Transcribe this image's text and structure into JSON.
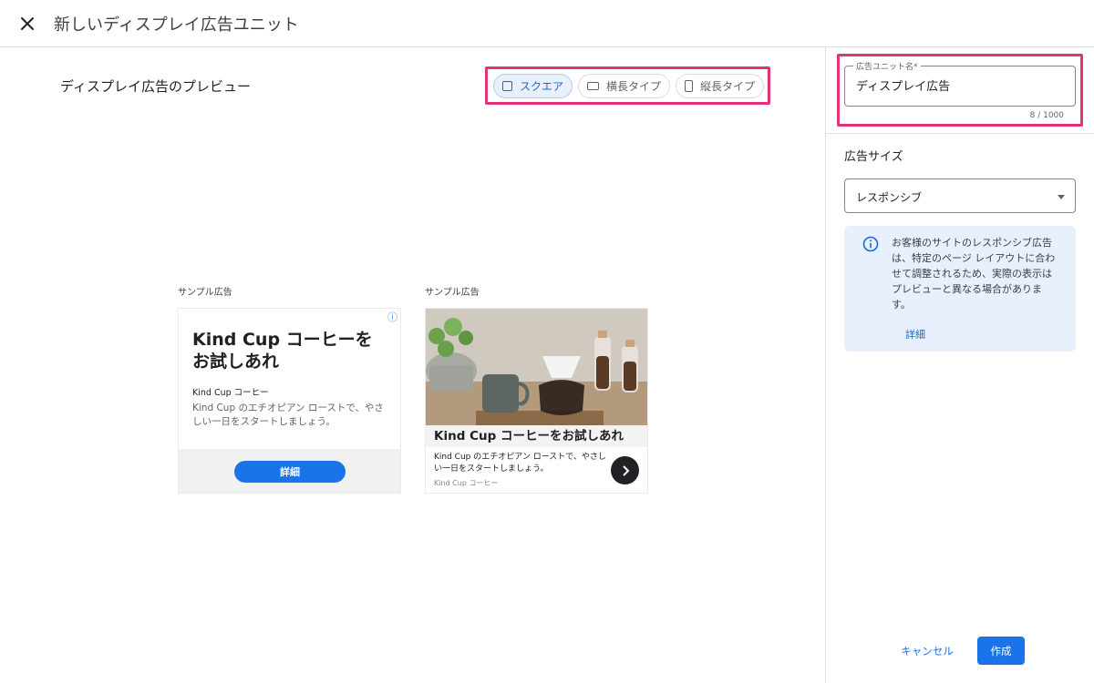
{
  "header": {
    "title": "新しいディスプレイ広告ユニット",
    "close_icon": "close-icon"
  },
  "preview": {
    "title": "ディスプレイ広告のプレビュー",
    "shapes": [
      {
        "label": "スクエア",
        "icon": "square-icon",
        "active": true
      },
      {
        "label": "横長タイプ",
        "icon": "landscape-icon",
        "active": false
      },
      {
        "label": "縦長タイプ",
        "icon": "portrait-icon",
        "active": false
      }
    ],
    "ads": [
      {
        "sample_label": "サンプル広告",
        "headline": "Kind Cup コーヒーを お試しあれ",
        "brand": "Kind Cup コーヒー",
        "body": "Kind Cup のエチオピアン ローストで、やさしい一日をスタートしましょう。",
        "button": "詳細",
        "info_icon": "info-icon"
      },
      {
        "sample_label": "サンプル広告",
        "headline": "Kind Cup コーヒーをお試しあれ",
        "body": "Kind Cup のエチオピアン ローストで、やさしい一日をスタートしましょう。",
        "brand": "Kind Cup コーヒー",
        "arrow_icon": "chevron-right-icon"
      }
    ]
  },
  "sidebar": {
    "name_field": {
      "label": "広告ユニット名*",
      "value": "ディスプレイ広告",
      "counter": "8 / 1000"
    },
    "size_title": "広告サイズ",
    "size_select": {
      "value": "レスポンシブ"
    },
    "note": {
      "text": "お客様のサイトのレスポンシブ広告は、特定のページ レイアウトに合わせて調整されるため、実際の表示はプレビューと異なる場合があります。",
      "link": "詳細",
      "icon": "info-icon"
    },
    "actions": {
      "cancel": "キャンセル",
      "create": "作成"
    }
  },
  "colors": {
    "accent": "#1a73e8",
    "highlight": "#e0337a",
    "note_bg": "#e8f0fe"
  }
}
